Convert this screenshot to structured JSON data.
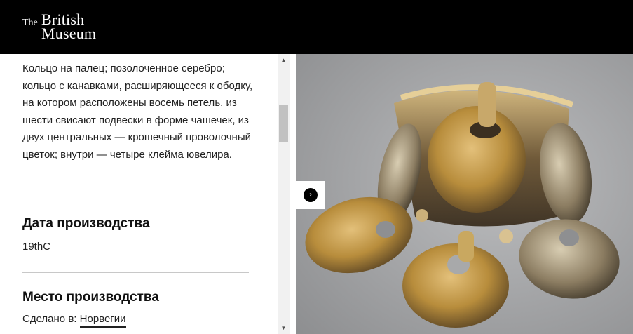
{
  "header": {
    "logo_the": "The",
    "logo_british": "British",
    "logo_museum": "Museum"
  },
  "details": {
    "description": "Кольцо на палец; позолоченное серебро; кольцо с канавками, расширяющееся к ободку, на котором расположены восемь петель, из шести свисают подвески в форме чашечек, из двух центральных — крошечный проволочный цветок; внутри — четыре клейма ювелира.",
    "production_date_heading": "Дата производства",
    "production_date_value": "19thC",
    "production_place_heading": "Место производства",
    "made_in_label": "Сделано в:",
    "made_in_value": "Норвегии"
  },
  "scrollbar": {
    "up_arrow": "▲",
    "down_arrow": "▼"
  },
  "image_viewer": {
    "next_icon": "›"
  },
  "colors": {
    "header_bg": "#000000",
    "scrollbar_track": "#f1f1f1",
    "scrollbar_thumb": "#c1c1c1",
    "image_bg": "#a8a9aa"
  }
}
